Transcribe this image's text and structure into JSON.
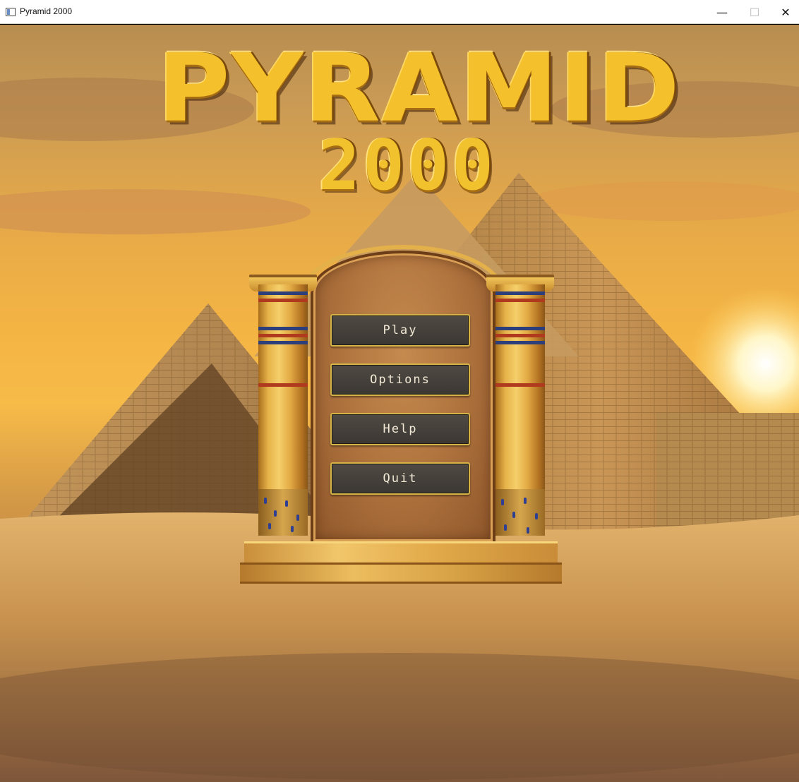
{
  "window": {
    "title": "Pyramid 2000",
    "minimize_glyph": "—",
    "maximize_glyph": "☐",
    "close_glyph": "✕"
  },
  "logo": {
    "main": "PYRAMID",
    "sub": "2000"
  },
  "menu": {
    "play_label": "Play",
    "options_label": "Options",
    "help_label": "Help",
    "quit_label": "Quit"
  },
  "icons": {
    "app": "app-window-icon"
  },
  "colors": {
    "logo_gold": "#f4c12c",
    "button_bg": "#45403a",
    "button_border": "#d6b347",
    "button_text": "#f2ead6",
    "sky": "#f4b444",
    "sand": "#c08743"
  }
}
